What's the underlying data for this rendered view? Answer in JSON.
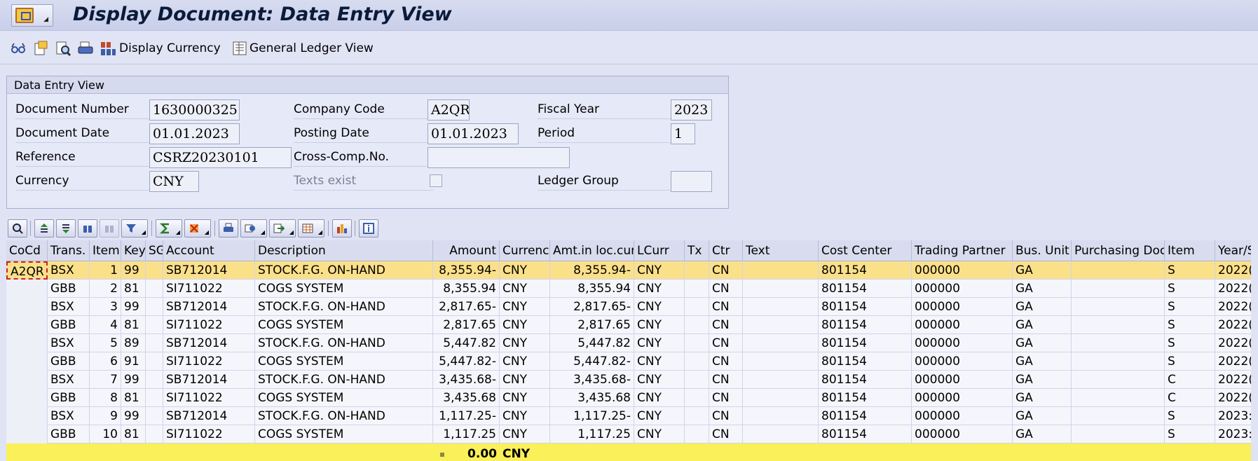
{
  "window": {
    "title": "Display Document: Data Entry View"
  },
  "toolbar": {
    "display_currency_label": "Display Currency",
    "general_ledger_view_label": "General Ledger View"
  },
  "header_group": {
    "title": "Data Entry View",
    "document_number": {
      "label": "Document Number",
      "value": "1630000325"
    },
    "company_code": {
      "label": "Company Code",
      "value": "A2QR"
    },
    "fiscal_year": {
      "label": "Fiscal Year",
      "value": "2023"
    },
    "document_date": {
      "label": "Document Date",
      "value": "01.01.2023"
    },
    "posting_date": {
      "label": "Posting Date",
      "value": "01.01.2023"
    },
    "period": {
      "label": "Period",
      "value": "1"
    },
    "reference": {
      "label": "Reference",
      "value": "CSRZ20230101"
    },
    "cross_comp": {
      "label": "Cross-Comp.No.",
      "value": ""
    },
    "currency": {
      "label": "Currency",
      "value": "CNY"
    },
    "texts_exist": {
      "label": "Texts exist",
      "checked": false
    },
    "ledger_group": {
      "label": "Ledger Group",
      "value": ""
    }
  },
  "grid": {
    "columns": [
      "CoCd",
      "Trans.",
      "Item",
      "Key",
      "SG",
      "Account",
      "Description",
      "Amount",
      "Currency",
      "Amt.in loc.cur.",
      "LCurr",
      "Tx",
      "Ctr",
      "Text",
      "Cost Center",
      "Trading Partner",
      "Bus. Unit",
      "Purchasing Doc.",
      "Item",
      "Year/S"
    ],
    "rows": [
      {
        "cocd": "A2QR",
        "trans": "BSX",
        "item": "1",
        "key": "99",
        "sg": "",
        "account": "SB712014",
        "description": "STOCK.F.G. ON-HAND",
        "amount": "8,355.94-",
        "currency": "CNY",
        "amt_loc": "8,355.94-",
        "lcurr": "CNY",
        "tx": "",
        "ctr": "CN",
        "text": "",
        "cost_center": "801154",
        "trading_partner": "000000",
        "bus_unit": "GA",
        "purch_doc": "",
        "item2": "S",
        "year": "2022("
      },
      {
        "cocd": "",
        "trans": "GBB",
        "item": "2",
        "key": "81",
        "sg": "",
        "account": "SI711022",
        "description": "COGS SYSTEM",
        "amount": "8,355.94",
        "currency": "CNY",
        "amt_loc": "8,355.94",
        "lcurr": "CNY",
        "tx": "",
        "ctr": "CN",
        "text": "",
        "cost_center": "801154",
        "trading_partner": "000000",
        "bus_unit": "GA",
        "purch_doc": "",
        "item2": "S",
        "year": "2022("
      },
      {
        "cocd": "",
        "trans": "BSX",
        "item": "3",
        "key": "99",
        "sg": "",
        "account": "SB712014",
        "description": "STOCK.F.G. ON-HAND",
        "amount": "2,817.65-",
        "currency": "CNY",
        "amt_loc": "2,817.65-",
        "lcurr": "CNY",
        "tx": "",
        "ctr": "CN",
        "text": "",
        "cost_center": "801154",
        "trading_partner": "000000",
        "bus_unit": "GA",
        "purch_doc": "",
        "item2": "S",
        "year": "2022("
      },
      {
        "cocd": "",
        "trans": "GBB",
        "item": "4",
        "key": "81",
        "sg": "",
        "account": "SI711022",
        "description": "COGS SYSTEM",
        "amount": "2,817.65",
        "currency": "CNY",
        "amt_loc": "2,817.65",
        "lcurr": "CNY",
        "tx": "",
        "ctr": "CN",
        "text": "",
        "cost_center": "801154",
        "trading_partner": "000000",
        "bus_unit": "GA",
        "purch_doc": "",
        "item2": "S",
        "year": "2022("
      },
      {
        "cocd": "",
        "trans": "BSX",
        "item": "5",
        "key": "89",
        "sg": "",
        "account": "SB712014",
        "description": "STOCK.F.G. ON-HAND",
        "amount": "5,447.82",
        "currency": "CNY",
        "amt_loc": "5,447.82",
        "lcurr": "CNY",
        "tx": "",
        "ctr": "CN",
        "text": "",
        "cost_center": "801154",
        "trading_partner": "000000",
        "bus_unit": "GA",
        "purch_doc": "",
        "item2": "S",
        "year": "2022("
      },
      {
        "cocd": "",
        "trans": "GBB",
        "item": "6",
        "key": "91",
        "sg": "",
        "account": "SI711022",
        "description": "COGS SYSTEM",
        "amount": "5,447.82-",
        "currency": "CNY",
        "amt_loc": "5,447.82-",
        "lcurr": "CNY",
        "tx": "",
        "ctr": "CN",
        "text": "",
        "cost_center": "801154",
        "trading_partner": "000000",
        "bus_unit": "GA",
        "purch_doc": "",
        "item2": "S",
        "year": "2022("
      },
      {
        "cocd": "",
        "trans": "BSX",
        "item": "7",
        "key": "99",
        "sg": "",
        "account": "SB712014",
        "description": "STOCK.F.G. ON-HAND",
        "amount": "3,435.68-",
        "currency": "CNY",
        "amt_loc": "3,435.68-",
        "lcurr": "CNY",
        "tx": "",
        "ctr": "CN",
        "text": "",
        "cost_center": "801154",
        "trading_partner": "000000",
        "bus_unit": "GA",
        "purch_doc": "",
        "item2": "C",
        "year": "2022("
      },
      {
        "cocd": "",
        "trans": "GBB",
        "item": "8",
        "key": "81",
        "sg": "",
        "account": "SI711022",
        "description": "COGS SYSTEM",
        "amount": "3,435.68",
        "currency": "CNY",
        "amt_loc": "3,435.68",
        "lcurr": "CNY",
        "tx": "",
        "ctr": "CN",
        "text": "",
        "cost_center": "801154",
        "trading_partner": "000000",
        "bus_unit": "GA",
        "purch_doc": "",
        "item2": "C",
        "year": "2022("
      },
      {
        "cocd": "",
        "trans": "BSX",
        "item": "9",
        "key": "99",
        "sg": "",
        "account": "SB712014",
        "description": "STOCK.F.G. ON-HAND",
        "amount": "1,117.25-",
        "currency": "CNY",
        "amt_loc": "1,117.25-",
        "lcurr": "CNY",
        "tx": "",
        "ctr": "CN",
        "text": "",
        "cost_center": "801154",
        "trading_partner": "000000",
        "bus_unit": "GA",
        "purch_doc": "",
        "item2": "S",
        "year": "2023:"
      },
      {
        "cocd": "",
        "trans": "GBB",
        "item": "10",
        "key": "81",
        "sg": "",
        "account": "SI711022",
        "description": "COGS SYSTEM",
        "amount": "1,117.25",
        "currency": "CNY",
        "amt_loc": "1,117.25",
        "lcurr": "CNY",
        "tx": "",
        "ctr": "CN",
        "text": "",
        "cost_center": "801154",
        "trading_partner": "000000",
        "bus_unit": "GA",
        "purch_doc": "",
        "item2": "S",
        "year": "2023:"
      }
    ],
    "total": {
      "amount": "0.00",
      "currency": "CNY"
    }
  },
  "colors": {
    "selected_row": "#fbe08a",
    "total_row": "#faf05a",
    "header_bg": "#d8dcee"
  }
}
